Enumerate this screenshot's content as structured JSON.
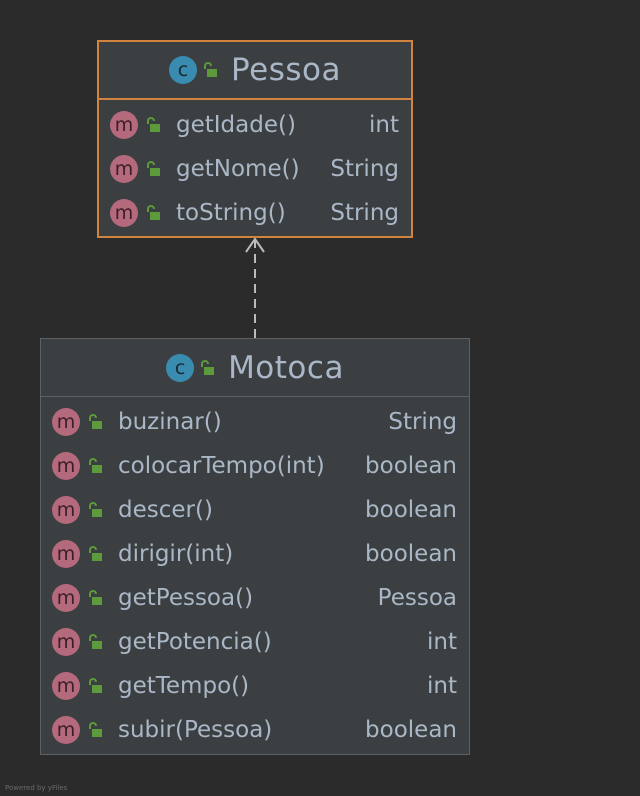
{
  "diagram": {
    "classes": [
      {
        "name": "Pessoa",
        "stereotype": "c",
        "methods": [
          {
            "badge": "m",
            "name": "getIdade()",
            "type": "int"
          },
          {
            "badge": "m",
            "name": "getNome()",
            "type": "String"
          },
          {
            "badge": "m",
            "name": "toString()",
            "type": "String"
          }
        ]
      },
      {
        "name": "Motoca",
        "stereotype": "c",
        "methods": [
          {
            "badge": "m",
            "name": "buzinar()",
            "type": "String"
          },
          {
            "badge": "m",
            "name": "colocarTempo(int)",
            "type": "boolean"
          },
          {
            "badge": "m",
            "name": "descer()",
            "type": "boolean"
          },
          {
            "badge": "m",
            "name": "dirigir(int)",
            "type": "boolean"
          },
          {
            "badge": "m",
            "name": "getPessoa()",
            "type": "Pessoa"
          },
          {
            "badge": "m",
            "name": "getPotencia()",
            "type": "int"
          },
          {
            "badge": "m",
            "name": "getTempo()",
            "type": "int"
          },
          {
            "badge": "m",
            "name": "subir(Pessoa)",
            "type": "boolean"
          }
        ]
      }
    ],
    "relations": [
      {
        "from": "Motoca",
        "to": "Pessoa",
        "kind": "dependency",
        "style": "dashed-open-arrow"
      }
    ]
  },
  "footer": {
    "text": "Powered by yFiles"
  },
  "colors": {
    "background": "#2b2b2b",
    "box": "#3c3f41",
    "selected_border": "#d1843b",
    "border": "#5e6163",
    "class_badge": "#3a8bb0",
    "method_badge": "#b46a7c",
    "lock": "#5c9a3c",
    "text": "#a9b7c6"
  },
  "icons": {
    "class_badge": "class-c-icon",
    "method_badge": "method-m-icon",
    "visibility": "public-lock-icon"
  }
}
